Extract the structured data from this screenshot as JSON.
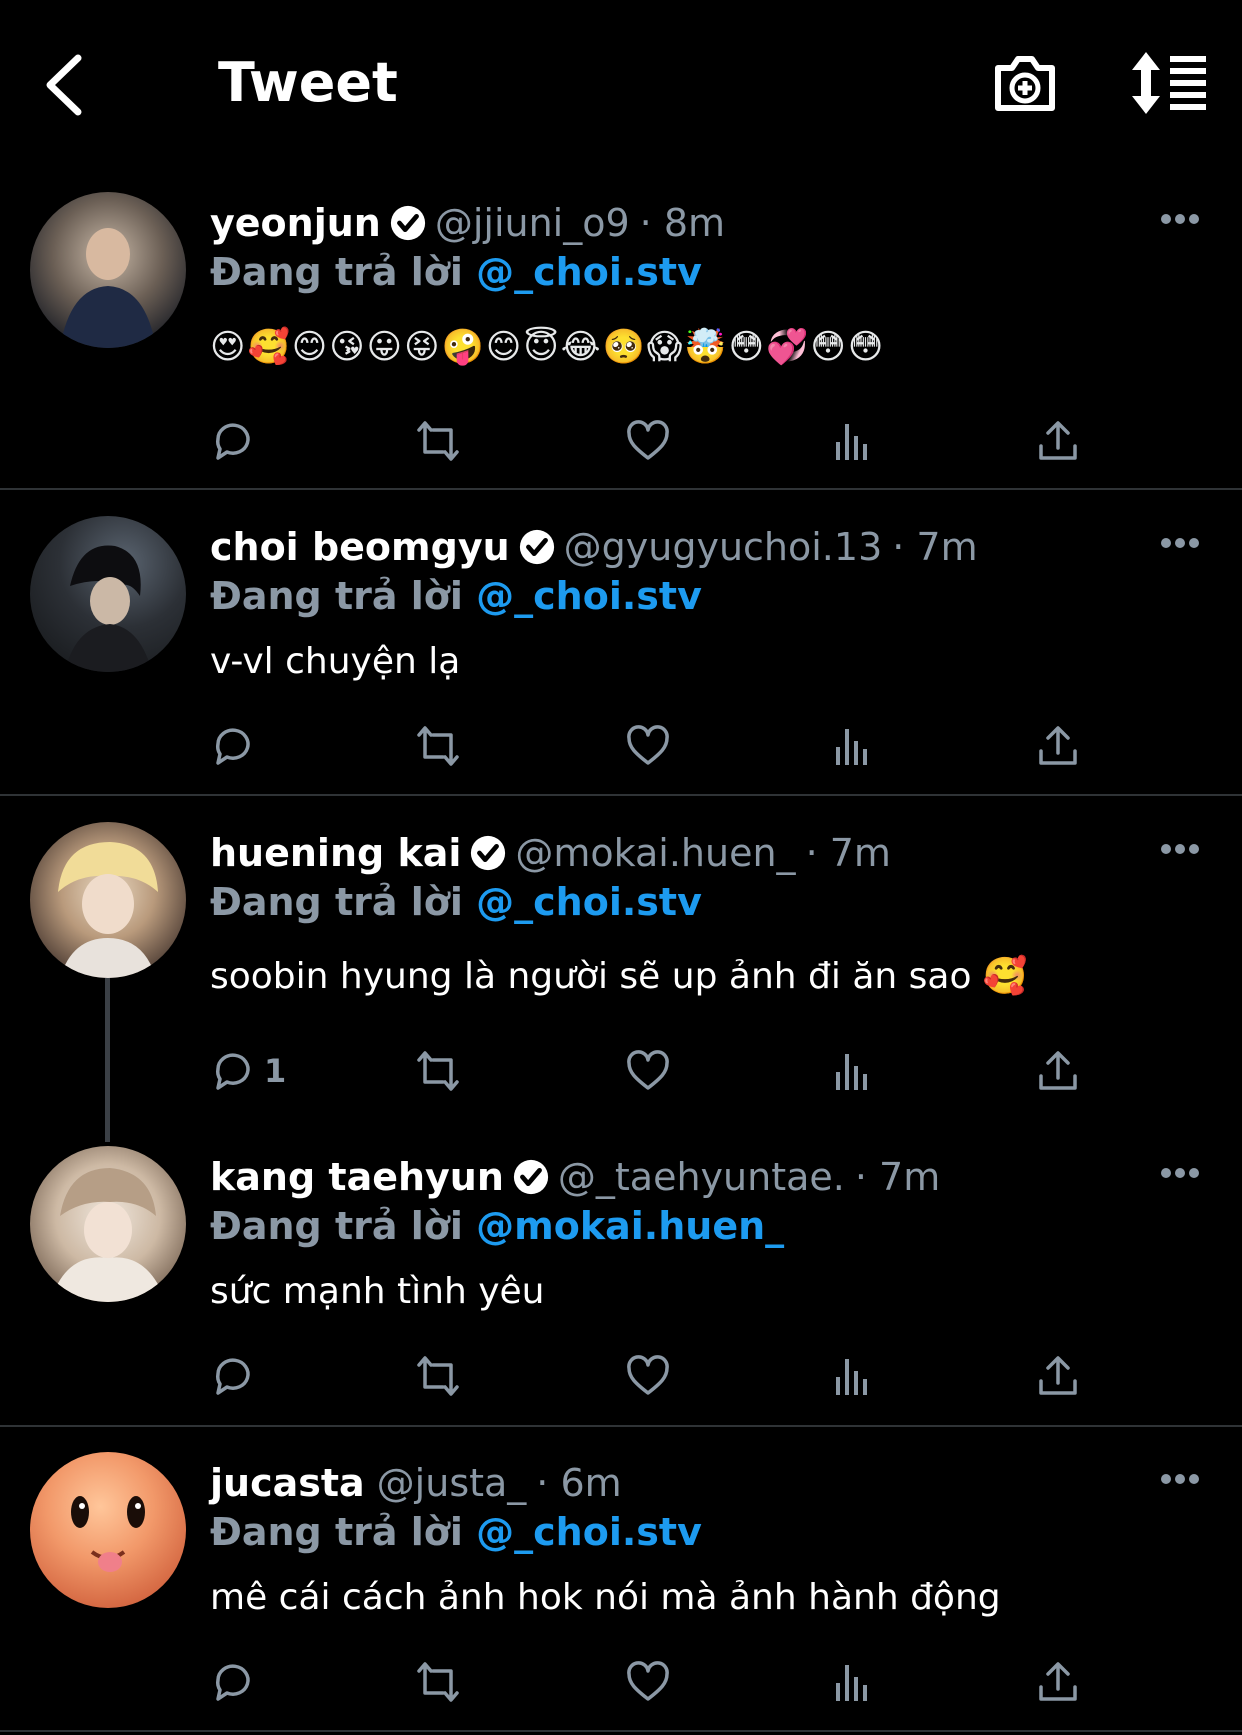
{
  "header": {
    "title": "Tweet",
    "back_icon": "chevron-left-icon",
    "camera_icon": "camera-plus-icon",
    "sort_icon": "sort-list-icon"
  },
  "reply_prefix": "Đang trả lời",
  "tweets": [
    {
      "name": "yeonjun",
      "verified": true,
      "handle": "@jjiuni_o9",
      "time": "· 8m",
      "reply_to": "@_choi.stv",
      "text": "😍🥰😊😘😛😝🤪😊😇😂🥺😱🤯😳💞😳😳",
      "reply_count": ""
    },
    {
      "name": "choi beomgyu",
      "verified": true,
      "handle": "@gyugyuchoi.13",
      "time": "· 7m",
      "reply_to": "@_choi.stv",
      "text": "v-vl chuyện lạ",
      "reply_count": ""
    },
    {
      "name": "huening kai",
      "verified": true,
      "handle": "@mokai.huen_",
      "time": "· 7m",
      "reply_to": "@_choi.stv",
      "text": "soobin hyung là người sẽ up ảnh đi ăn sao 🥰",
      "reply_count": "1"
    },
    {
      "name": "kang taehyun",
      "verified": true,
      "handle": "@_taehyuntae.",
      "time": "· 7m",
      "reply_to": "@mokai.huen_",
      "text": "sức mạnh tình yêu",
      "reply_count": ""
    },
    {
      "name": "jucasta",
      "verified": false,
      "handle": "@justa_",
      "time": "· 6m",
      "reply_to": "@_choi.stv",
      "text": "mê cái cách ảnh hok nói mà ảnh hành động",
      "reply_count": ""
    }
  ],
  "colors": {
    "background": "#000000",
    "accent": "#1d9bf0",
    "muted": "#8b98a5",
    "divider": "#2f3336"
  }
}
